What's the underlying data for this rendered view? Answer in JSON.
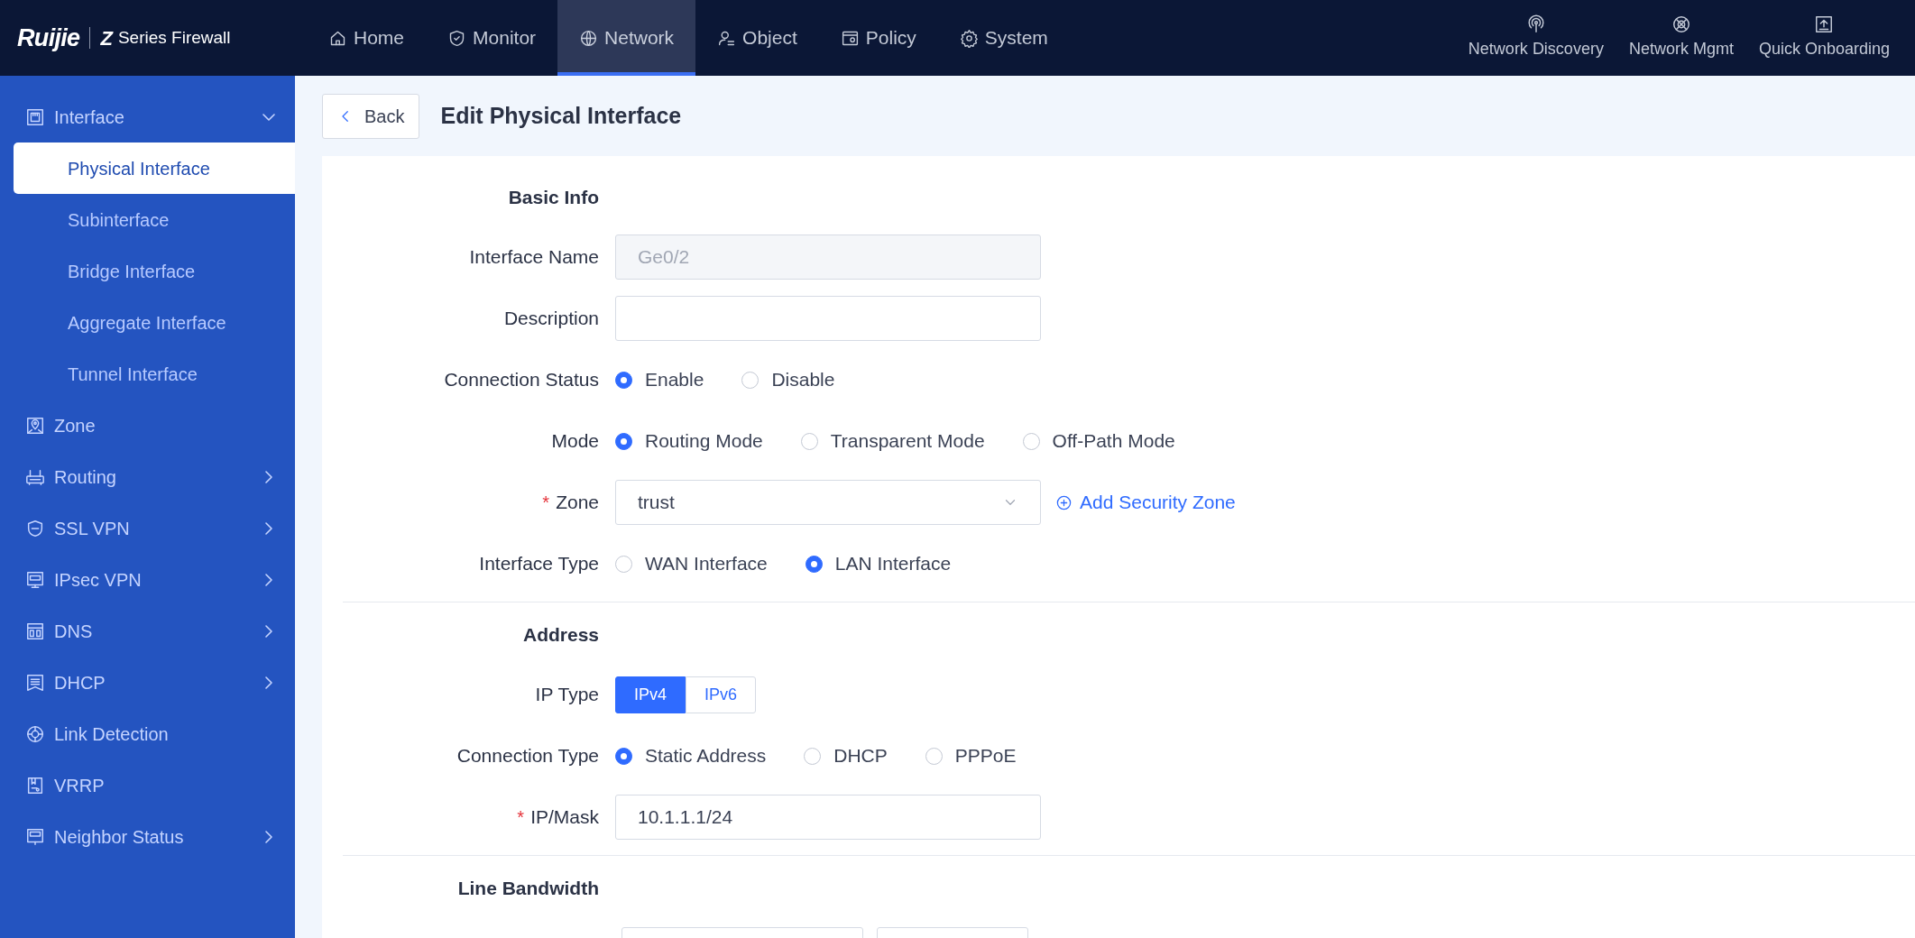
{
  "header": {
    "brand": "Ruijie",
    "series_mark": "Z",
    "product": "Series Firewall",
    "nav": [
      {
        "label": "Home",
        "selected": false
      },
      {
        "label": "Monitor",
        "selected": false
      },
      {
        "label": "Network",
        "selected": true
      },
      {
        "label": "Object",
        "selected": false
      },
      {
        "label": "Policy",
        "selected": false
      },
      {
        "label": "System",
        "selected": false
      }
    ],
    "tools": [
      {
        "label": "Network Discovery"
      },
      {
        "label": "Network Mgmt"
      },
      {
        "label": "Quick Onboarding"
      }
    ]
  },
  "sidebar": {
    "items": [
      {
        "label": "Interface",
        "kind": "group",
        "expanded": true,
        "children": [
          {
            "label": "Physical Interface",
            "selected": true
          },
          {
            "label": "Subinterface",
            "selected": false
          },
          {
            "label": "Bridge Interface",
            "selected": false
          },
          {
            "label": "Aggregate Interface",
            "selected": false
          },
          {
            "label": "Tunnel Interface",
            "selected": false
          }
        ]
      },
      {
        "label": "Zone",
        "kind": "link"
      },
      {
        "label": "Routing",
        "kind": "group",
        "expanded": false
      },
      {
        "label": "SSL VPN",
        "kind": "group",
        "expanded": false
      },
      {
        "label": "IPsec VPN",
        "kind": "group",
        "expanded": false
      },
      {
        "label": "DNS",
        "kind": "group",
        "expanded": false
      },
      {
        "label": "DHCP",
        "kind": "group",
        "expanded": false
      },
      {
        "label": "Link Detection",
        "kind": "link"
      },
      {
        "label": "VRRP",
        "kind": "link"
      },
      {
        "label": "Neighbor Status",
        "kind": "group",
        "expanded": false
      }
    ]
  },
  "page": {
    "back": "Back",
    "title": "Edit Physical Interface"
  },
  "form": {
    "sections": [
      {
        "title": "Basic Info",
        "rows": [
          {
            "kind": "input",
            "label": "Interface Name",
            "value": "Ge0/2",
            "disabled": true
          },
          {
            "kind": "input",
            "label": "Description"
          },
          {
            "kind": "radio",
            "label": "Connection Status",
            "options": [
              {
                "label": "Enable",
                "selected": true
              },
              {
                "label": "Disable",
                "selected": false
              }
            ]
          },
          {
            "kind": "radio",
            "label": "Mode",
            "options": [
              {
                "label": "Routing Mode",
                "selected": true
              },
              {
                "label": "Transparent Mode",
                "selected": false
              },
              {
                "label": "Off-Path Mode",
                "selected": false
              }
            ]
          },
          {
            "kind": "select",
            "label": "Zone",
            "value": "trust",
            "required_mark": "*",
            "link": "Add Security Zone"
          },
          {
            "kind": "radio",
            "label": "Interface Type",
            "options": [
              {
                "label": "WAN Interface",
                "selected": false
              },
              {
                "label": "LAN Interface",
                "selected": true
              }
            ]
          }
        ]
      },
      {
        "title": "Address",
        "rows": [
          {
            "kind": "segmented",
            "label": "IP Type",
            "options": [
              {
                "label": "IPv4",
                "selected": true
              },
              {
                "label": "IPv6",
                "selected": false
              }
            ]
          },
          {
            "kind": "radio",
            "label": "Connection Type",
            "options": [
              {
                "label": "Static Address",
                "selected": true
              },
              {
                "label": "DHCP",
                "selected": false
              },
              {
                "label": "PPPoE",
                "selected": false
              }
            ]
          },
          {
            "kind": "input",
            "label": "IP/Mask",
            "value": "10.1.1.1/24",
            "required_mark": "*"
          }
        ]
      },
      {
        "title": "Line Bandwidth",
        "rows": [
          {
            "kind": "pair"
          }
        ]
      }
    ]
  }
}
